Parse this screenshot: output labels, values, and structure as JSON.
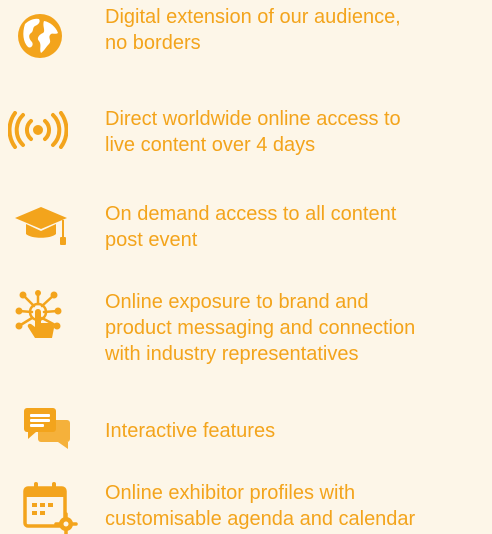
{
  "accent_color": "#f3a41c",
  "background_color": "#fdf6e8",
  "features": [
    {
      "icon": "globe-icon",
      "lines": [
        "Digital extension of our audience,",
        "no borders"
      ]
    },
    {
      "icon": "broadcast-icon",
      "lines": [
        "Direct worldwide online access to",
        "live content over 4 days"
      ]
    },
    {
      "icon": "graduation-cap-icon",
      "lines": [
        "On demand access to all content",
        "post event"
      ]
    },
    {
      "icon": "touch-network-icon",
      "lines": [
        "Online exposure to brand and",
        "product messaging and connection",
        "with industry representatives"
      ]
    },
    {
      "icon": "chat-bubbles-icon",
      "lines": [
        "Interactive features"
      ]
    },
    {
      "icon": "calendar-settings-icon",
      "lines": [
        "Online exhibitor profiles with",
        "customisable agenda and calendar"
      ]
    }
  ]
}
